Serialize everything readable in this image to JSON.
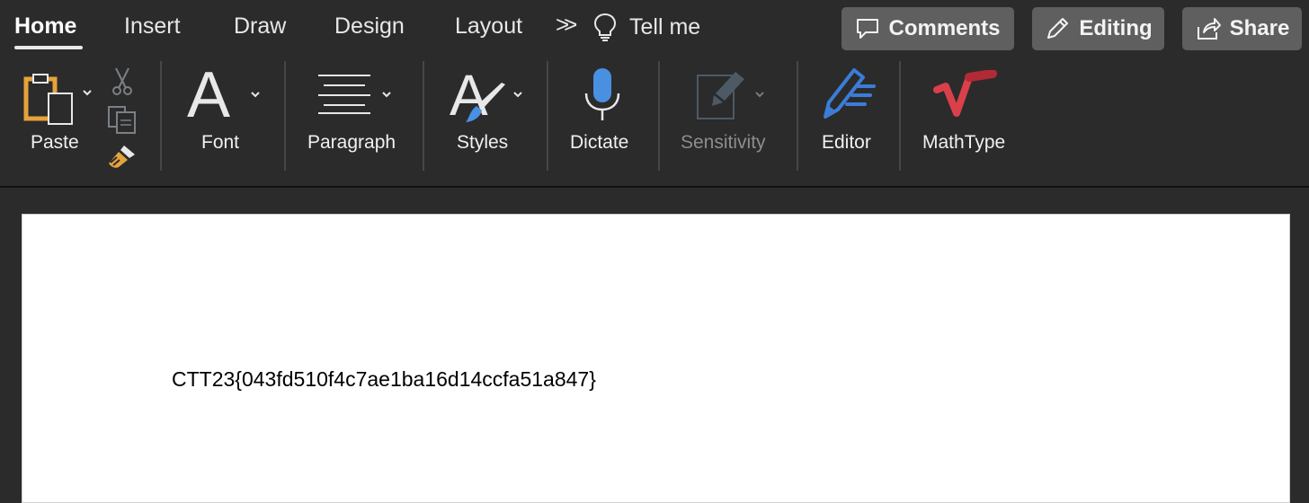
{
  "tabs": {
    "home": "Home",
    "insert": "Insert",
    "draw": "Draw",
    "design": "Design",
    "layout": "Layout",
    "more": ">>",
    "tell_me": "Tell me"
  },
  "header_buttons": {
    "comments": "Comments",
    "editing": "Editing",
    "share": "Share"
  },
  "ribbon": {
    "paste": "Paste",
    "font": "Font",
    "paragraph": "Paragraph",
    "styles": "Styles",
    "dictate": "Dictate",
    "sensitivity": "Sensitivity",
    "editor": "Editor",
    "mathtype": "MathType"
  },
  "icons": {
    "paste": "clipboard-icon",
    "cut": "scissors-icon",
    "copy": "copy-icon",
    "format_painter": "paintbrush-icon",
    "font": "font-letter-a-icon",
    "paragraph": "align-lines-icon",
    "styles": "styles-brush-icon",
    "dictate": "microphone-icon",
    "sensitivity": "sensitivity-label-icon",
    "editor": "editor-pen-icon",
    "mathtype": "mathtype-radical-icon",
    "tell_me": "lightbulb-icon",
    "comments": "comment-bubble-icon",
    "editing": "pencil-icon",
    "share": "share-icon"
  },
  "colors": {
    "background": "#2b2b2b",
    "button": "#5f5f5f",
    "paste_accent": "#e6a23c",
    "dictate_blue": "#4a90e2",
    "editor_blue": "#3b7dd8",
    "mathtype_red": "#d9404a",
    "page": "#ffffff"
  },
  "document": {
    "text": "CTT23{043fd510f4c7ae1ba16d14ccfa51a847}"
  }
}
